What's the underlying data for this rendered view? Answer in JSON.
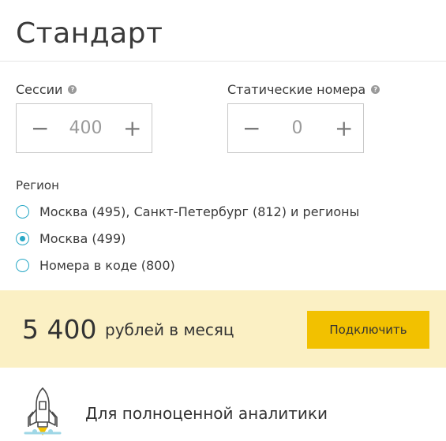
{
  "plan": {
    "title": "Стандарт"
  },
  "sessions": {
    "label": "Сессии",
    "help_icon": "?",
    "minus": "−",
    "value": "400",
    "plus": "+"
  },
  "static_numbers": {
    "label": "Статические номера",
    "help_icon": "?",
    "minus": "−",
    "value": "0",
    "plus": "+"
  },
  "region": {
    "label": "Регион",
    "options": [
      {
        "label": "Москва (495), Санкт-Петербург (812) и регионы",
        "selected": false
      },
      {
        "label": "Москва (499)",
        "selected": true
      },
      {
        "label": "Номера в коде (800)",
        "selected": false
      }
    ]
  },
  "price": {
    "amount": "5 400",
    "unit": "рублей в месяц",
    "connect_label": "Подключить"
  },
  "feature": {
    "icon": "rocket-icon",
    "text": "Для полноценной аналитики"
  },
  "colors": {
    "accent": "#29a8c6",
    "button": "#f2c100",
    "price_band": "#fbf0c4"
  }
}
